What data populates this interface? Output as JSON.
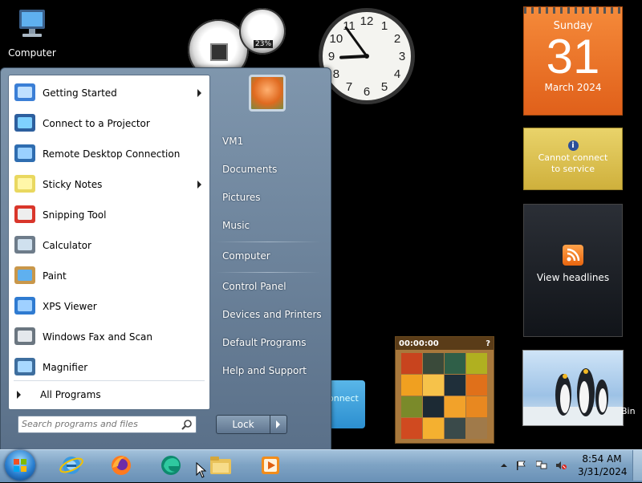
{
  "desktop": {
    "computer_label": "Computer",
    "bin_label": "Bin",
    "connect_label": "onnect"
  },
  "gadgets": {
    "cpu_meter": {
      "ram_percent_label": "23%"
    },
    "calendar": {
      "weekday": "Sunday",
      "day": "31",
      "month_year": "March 2024"
    },
    "weather": {
      "message": "Cannot connect to service"
    },
    "feed": {
      "message": "View headlines"
    },
    "puzzle": {
      "timer": "00:00:00",
      "help": "?"
    },
    "clock": {
      "hour": 8.9,
      "minute": 54
    }
  },
  "start_menu": {
    "programs": [
      {
        "label": "Getting Started",
        "submenu": true,
        "icon": "getting-started-icon"
      },
      {
        "label": "Connect to a Projector",
        "submenu": false,
        "icon": "projector-icon"
      },
      {
        "label": "Remote Desktop Connection",
        "submenu": false,
        "icon": "remote-desktop-icon"
      },
      {
        "label": "Sticky Notes",
        "submenu": true,
        "icon": "sticky-notes-icon"
      },
      {
        "label": "Snipping Tool",
        "submenu": false,
        "icon": "snipping-tool-icon"
      },
      {
        "label": "Calculator",
        "submenu": false,
        "icon": "calculator-icon"
      },
      {
        "label": "Paint",
        "submenu": false,
        "icon": "paint-icon"
      },
      {
        "label": "XPS Viewer",
        "submenu": false,
        "icon": "xps-viewer-icon"
      },
      {
        "label": "Windows Fax and Scan",
        "submenu": false,
        "icon": "fax-scan-icon"
      },
      {
        "label": "Magnifier",
        "submenu": false,
        "icon": "magnifier-icon"
      }
    ],
    "all_programs": "All Programs",
    "search_placeholder": "Search programs and files",
    "right_links": {
      "user": "VM1",
      "documents": "Documents",
      "pictures": "Pictures",
      "music": "Music",
      "computer": "Computer",
      "control_panel": "Control Panel",
      "devices": "Devices and Printers",
      "defaults": "Default Programs",
      "help": "Help and Support"
    },
    "shutdown_label": "Lock"
  },
  "taskbar": {
    "time": "8:54 AM",
    "date": "3/31/2024"
  },
  "colors": {
    "accent_calendar": "#e8701f",
    "taskbar": "#7ea3c4"
  }
}
